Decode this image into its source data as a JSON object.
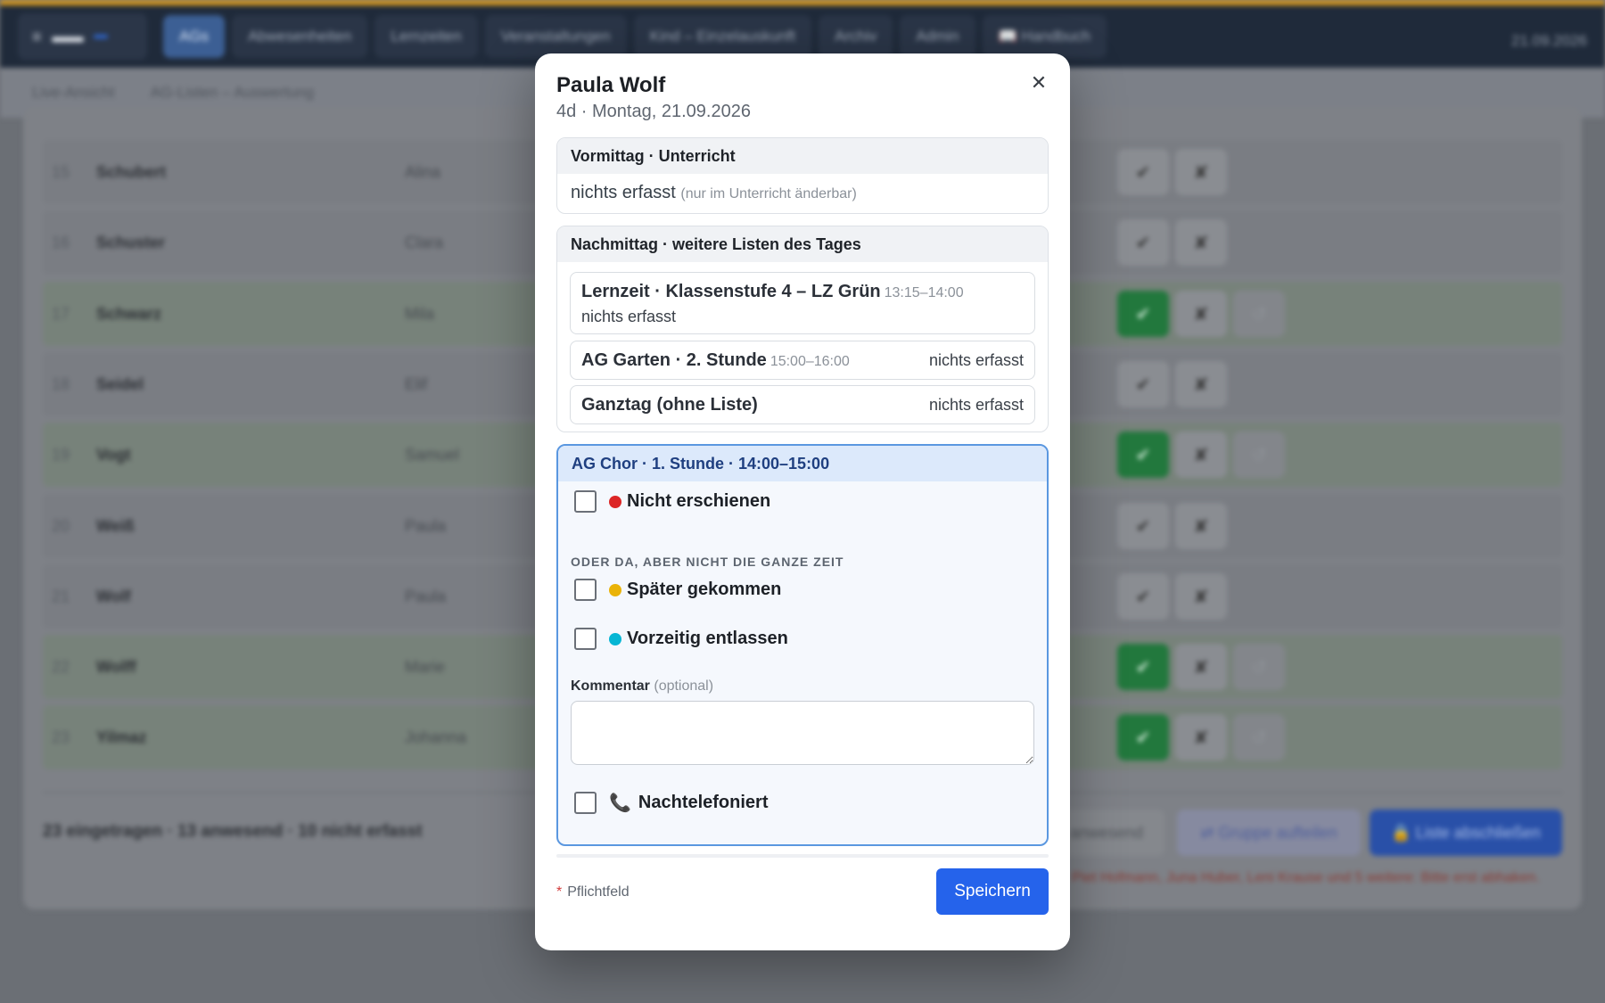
{
  "colors": {
    "accent": "#2563eb",
    "present": "#22783d",
    "absent_dot": "#dc2626",
    "late_dot": "#eab308",
    "early_dot": "#06b6d4"
  },
  "topbar": {
    "brand_tag": "",
    "tabs": [
      "AGs",
      "Abwesenheiten",
      "Lernzeiten",
      "Veranstaltungen",
      "Kind – Einzelauskunft",
      "Archiv",
      "Admin",
      "📖 Handbuch"
    ],
    "date": "21.09.2026"
  },
  "subnav": [
    "Live-Ansicht",
    "AG-Listen – Auswertung"
  ],
  "list": {
    "rows": [
      {
        "nr": "15",
        "last": "Schubert",
        "first": "Alina",
        "present": false
      },
      {
        "nr": "16",
        "last": "Schuster",
        "first": "Clara",
        "present": false
      },
      {
        "nr": "17",
        "last": "Schwarz",
        "first": "Mila",
        "present": true
      },
      {
        "nr": "18",
        "last": "Seidel",
        "first": "Elif",
        "present": false
      },
      {
        "nr": "19",
        "last": "Vogt",
        "first": "Samuel",
        "present": true
      },
      {
        "nr": "20",
        "last": "Weiß",
        "first": "Paula",
        "present": false
      },
      {
        "nr": "21",
        "last": "Wolf",
        "first": "Paula",
        "present": false
      },
      {
        "nr": "22",
        "last": "Wolff",
        "first": "Marie",
        "present": true
      },
      {
        "nr": "23",
        "last": "Yilmaz",
        "first": "Johanna",
        "present": true
      }
    ],
    "summary": "23 eingetragen · 13 anwesend · 10 nicht erfasst",
    "btn_anwesend": "anwesend",
    "btn_group": "⇄ Gruppe aufteilen",
    "btn_close": "🔒 Liste abschließen",
    "warning": "Piet Hofmann, Juna Huber, Leni Krause und 5 weitere: Bitte erst abhaken."
  },
  "modal": {
    "title": "Paula Wolf",
    "subtitle": "4d · Montag, 21.09.2026",
    "morning": {
      "header": "Vormittag · Unterricht",
      "status": "nichts erfasst",
      "hint": "(nur im Unterricht änderbar)"
    },
    "afternoon": {
      "header": "Nachmittag · weitere Listen des Tages",
      "items": [
        {
          "name": "Lernzeit · Klassenstufe 4 – LZ Grün",
          "time": "13:15–14:00",
          "status": "nichts erfasst"
        },
        {
          "name": "AG Garten · 2. Stunde",
          "time": "15:00–16:00",
          "status": "nichts erfasst"
        },
        {
          "name": "Ganztag (ohne Liste)",
          "time": "",
          "status": "nichts erfasst"
        }
      ]
    },
    "current": {
      "header": "AG Chor · 1. Stunde · 14:00–15:00",
      "absent_label": "Nicht erschienen",
      "section_label": "ODER DA, ABER NICHT DIE GANZE ZEIT",
      "late_label": "Später gekommen",
      "early_label": "Vorzeitig entlassen",
      "comment_label": "Kommentar",
      "comment_optional": "(optional)",
      "comment_value": "",
      "phoned_label": "Nachtelefoniert"
    },
    "required_note": "Pflichtfeld",
    "required_star": "*",
    "save_label": "Speichern"
  }
}
